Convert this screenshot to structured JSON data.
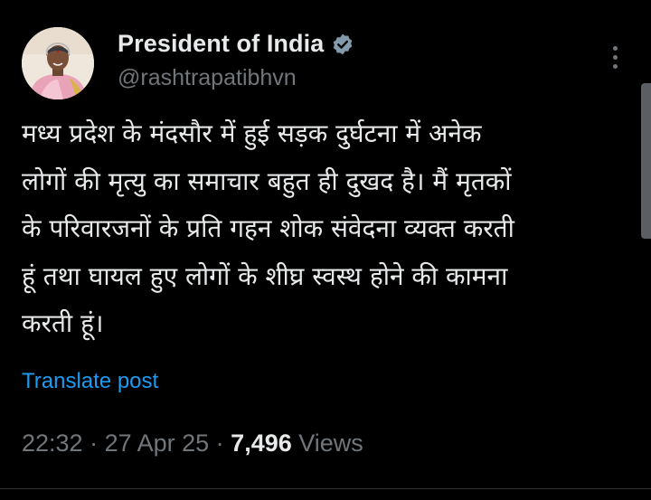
{
  "author": {
    "display_name": "President of India",
    "handle": "@rashtrapatibhvn",
    "verified_badge": "verified-badge-icon",
    "badge_color": "#829aab"
  },
  "post": {
    "text_lines": [
      "मध्य प्रदेश के मंदसौर में हुई सड़क दुर्घटना में अनेक",
      "लोगों की मृत्यु का समाचार बहुत ही दुखद है। मैं मृतकों",
      "के  परिवारजनों के प्रति गहन शोक संवेदना व्यक्त करती",
      "हूं तथा घायल हुए लोगों के शीघ्र स्वस्थ होने की कामना",
      "करती हूं।"
    ],
    "translate_label": "Translate post"
  },
  "meta": {
    "time": "22:32",
    "separator": " · ",
    "date": "27 Apr 25",
    "views_count": "7,496",
    "views_label": " Views"
  },
  "colors": {
    "background": "#000000",
    "text_primary": "#e7e9ea",
    "text_secondary": "#71767b",
    "link": "#1d9bf0"
  }
}
